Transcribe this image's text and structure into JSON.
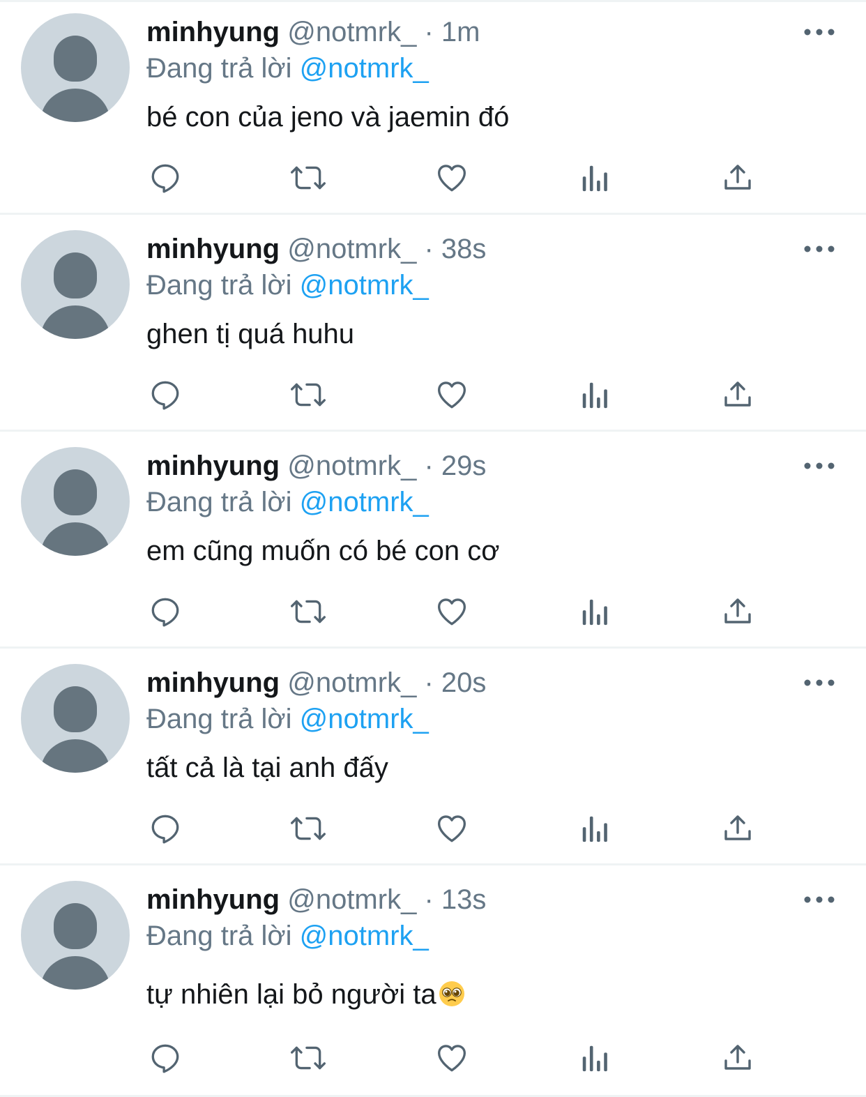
{
  "tweets": [
    {
      "name": "minhyung",
      "handle": "@notmrk_",
      "separator": "·",
      "time": "1m",
      "reply_prefix": "Đang trả lời",
      "reply_to": "@notmrk_",
      "text": "bé con của jeno và jaemin đó"
    },
    {
      "name": "minhyung",
      "handle": "@notmrk_",
      "separator": "·",
      "time": "38s",
      "reply_prefix": "Đang trả lời",
      "reply_to": "@notmrk_",
      "text": "ghen tị quá huhu"
    },
    {
      "name": "minhyung",
      "handle": "@notmrk_",
      "separator": "·",
      "time": "29s",
      "reply_prefix": "Đang trả lời",
      "reply_to": "@notmrk_",
      "text": "em cũng muốn có bé con cơ"
    },
    {
      "name": "minhyung",
      "handle": "@notmrk_",
      "separator": "·",
      "time": "20s",
      "reply_prefix": "Đang trả lời",
      "reply_to": "@notmrk_",
      "text": "tất cả là tại anh đấy"
    },
    {
      "name": "minhyung",
      "handle": "@notmrk_",
      "separator": "·",
      "time": "13s",
      "reply_prefix": "Đang trả lời",
      "reply_to": "@notmrk_",
      "text": "tự nhiên lại bỏ người ta",
      "emoji": "pleading-face"
    }
  ],
  "icons": {
    "avatar": "default-avatar-icon",
    "more": "more-options-icon",
    "reply": "reply-icon",
    "retweet": "retweet-icon",
    "like": "heart-icon",
    "views": "views-icon",
    "share": "share-icon"
  },
  "colors": {
    "text_primary": "#14171a",
    "text_secondary": "#657786",
    "mention": "#1da1f2",
    "divider": "#eff3f4",
    "avatar_bg": "#ccd6dd",
    "avatar_fg": "#66757f",
    "icon": "#536471"
  }
}
